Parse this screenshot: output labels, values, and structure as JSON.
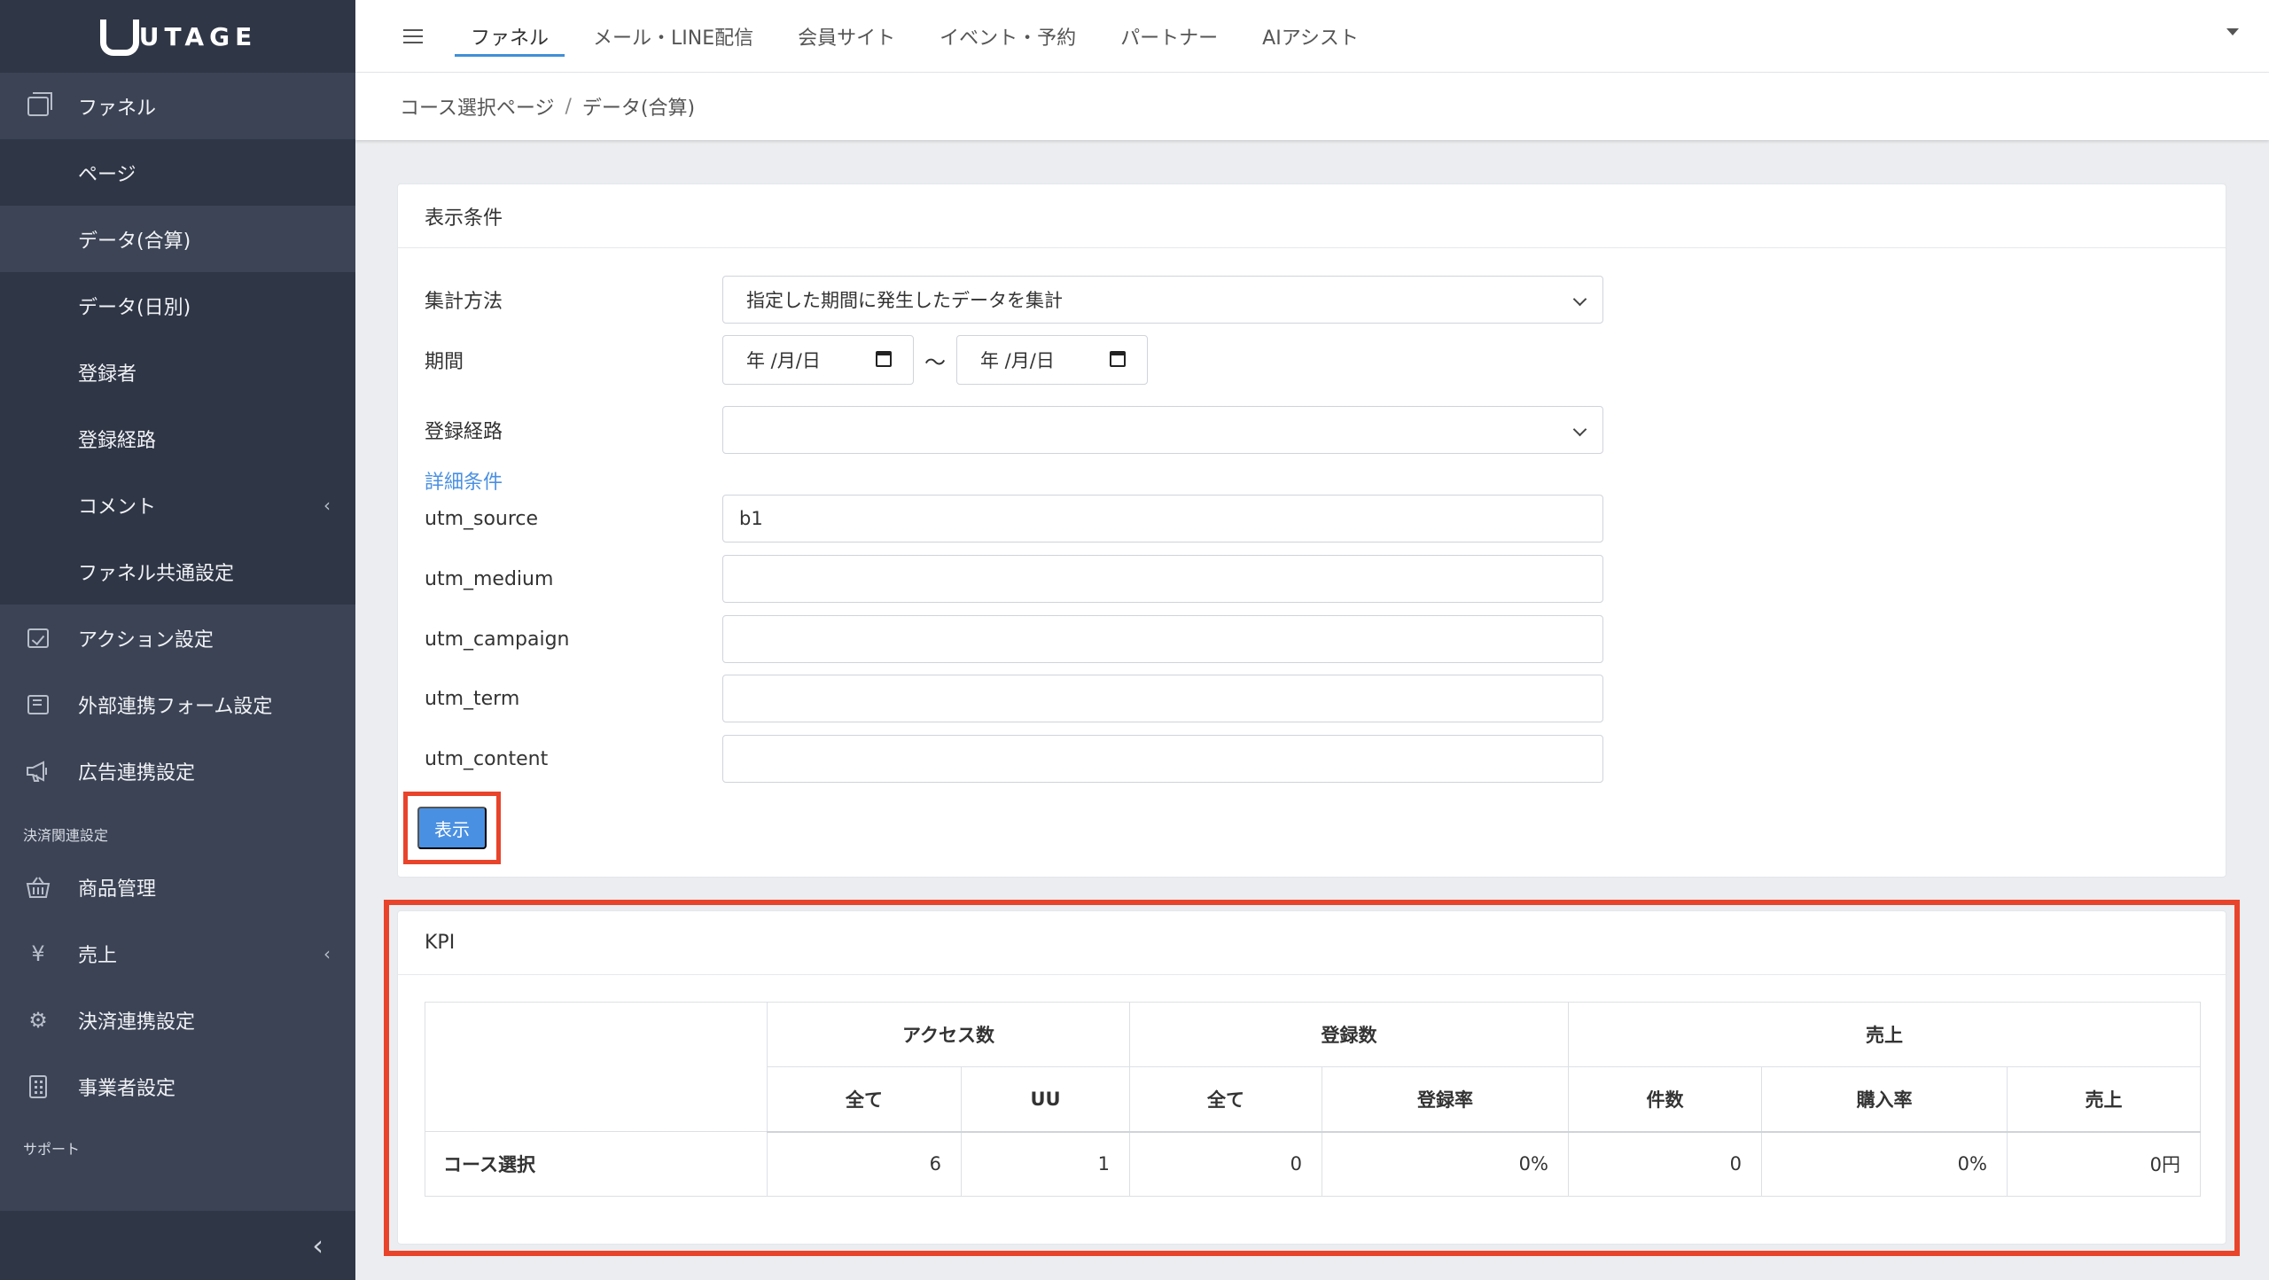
{
  "app": {
    "logo_text": "UTAGE"
  },
  "sidebar": {
    "items": [
      {
        "label": "ファネル",
        "icon": "funnel-pages-icon"
      },
      {
        "label": "ページ"
      },
      {
        "label": "データ(合算)"
      },
      {
        "label": "データ(日別)"
      },
      {
        "label": "登録者"
      },
      {
        "label": "登録経路"
      },
      {
        "label": "コメント"
      },
      {
        "label": "ファネル共通設定"
      },
      {
        "label": "アクション設定",
        "icon": "checkbox-icon"
      },
      {
        "label": "外部連携フォーム設定",
        "icon": "form-icon"
      },
      {
        "label": "広告連携設定",
        "icon": "megaphone-icon"
      }
    ],
    "section_payment": "決済関連設定",
    "payment_items": [
      {
        "label": "商品管理",
        "icon": "basket-icon"
      },
      {
        "label": "売上",
        "icon": "yen-icon"
      },
      {
        "label": "決済連携設定",
        "icon": "gear-icon"
      },
      {
        "label": "事業者設定",
        "icon": "building-icon"
      }
    ],
    "section_support": "サポート"
  },
  "topnav": {
    "tabs": [
      {
        "label": "ファネル"
      },
      {
        "label": "メール・LINE配信"
      },
      {
        "label": "会員サイト"
      },
      {
        "label": "イベント・予約"
      },
      {
        "label": "パートナー"
      },
      {
        "label": "AIアシスト"
      }
    ]
  },
  "breadcrumb": {
    "parent": "コース選択ページ",
    "sep": "/",
    "current": "データ(合算)"
  },
  "filters": {
    "title": "表示条件",
    "agg_label": "集計方法",
    "agg_value": "指定した期間に発生したデータを集計",
    "period_label": "期間",
    "date_from": "年 /月/日",
    "date_sep": "〜",
    "date_to": "年 /月/日",
    "route_label": "登録経路",
    "route_value": "",
    "detail_link": "詳細条件",
    "utm": [
      {
        "label": "utm_source",
        "value": "b1"
      },
      {
        "label": "utm_medium",
        "value": ""
      },
      {
        "label": "utm_campaign",
        "value": ""
      },
      {
        "label": "utm_term",
        "value": ""
      },
      {
        "label": "utm_content",
        "value": ""
      }
    ],
    "submit_label": "表示"
  },
  "kpi": {
    "title": "KPI",
    "group_headers": [
      "アクセス数",
      "登録数",
      "売上"
    ],
    "sub_headers": [
      "全て",
      "UU",
      "全て",
      "登録率",
      "件数",
      "購入率",
      "売上"
    ],
    "rows": [
      {
        "label": "コース選択",
        "values": [
          "6",
          "1",
          "0",
          "0%",
          "0",
          "0%",
          "0円"
        ]
      }
    ]
  },
  "colors": {
    "sidebar_bg": "#3b4355",
    "accent": "#4a90e2",
    "highlight": "#e8442b"
  }
}
